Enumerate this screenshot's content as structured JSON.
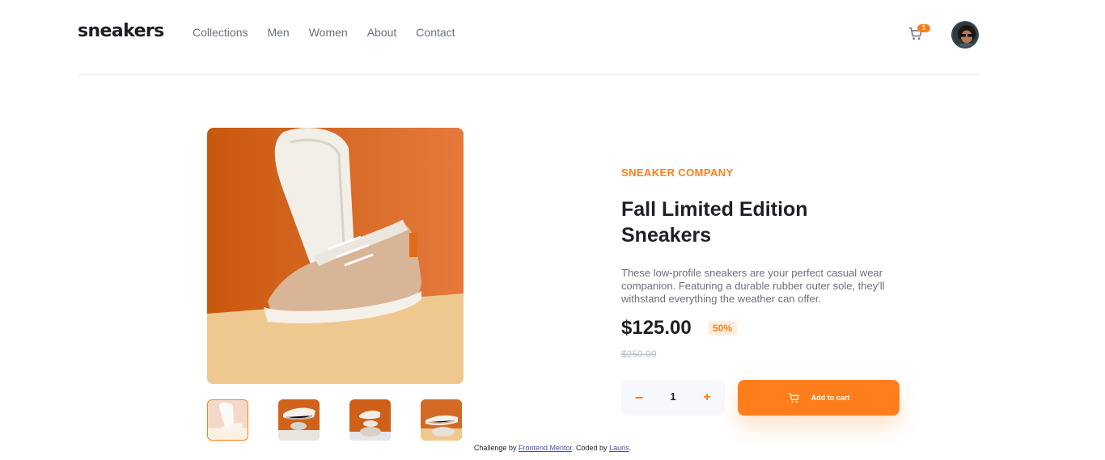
{
  "brand": {
    "logo_text": "sneakers",
    "accent_color": "#ff7e1b"
  },
  "nav": {
    "items": [
      {
        "label": "Collections"
      },
      {
        "label": "Men"
      },
      {
        "label": "Women"
      },
      {
        "label": "About"
      },
      {
        "label": "Contact"
      }
    ]
  },
  "cart": {
    "icon": "cart-icon",
    "badge_count": "1"
  },
  "user": {
    "avatar": "user-avatar"
  },
  "gallery": {
    "main_image": "product-image-1",
    "thumbnails": [
      {
        "name": "product-thumbnail-1",
        "active": true
      },
      {
        "name": "product-thumbnail-2",
        "active": false
      },
      {
        "name": "product-thumbnail-3",
        "active": false
      },
      {
        "name": "product-thumbnail-4",
        "active": false
      }
    ]
  },
  "product": {
    "company": "SNEAKER COMPANY",
    "title_line1": "Fall Limited Edition",
    "title_line2": "Sneakers",
    "description": "These low-profile sneakers are your perfect casual wear companion. Featuring a durable rubber outer sole, they'll withstand everything the weather can offer.",
    "price": "$125.00",
    "discount": "50%",
    "old_price": "$250.00"
  },
  "quantity": {
    "minus": "−",
    "value": "1",
    "plus": "+"
  },
  "add_to_cart": {
    "label": "Add to cart"
  },
  "attribution": {
    "prefix": "Challenge by",
    "link1": "Frontend Mentor",
    "middle": ". Coded by",
    "link2": "Lauris",
    "suffix": "."
  }
}
